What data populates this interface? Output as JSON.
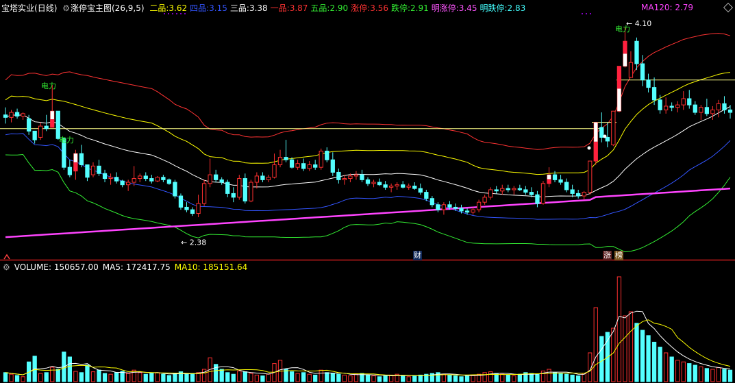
{
  "header": {
    "stock": "宝塔实业",
    "period": "(日线)",
    "indicator": "涨停宝主图",
    "params": "(26,9,5)",
    "items": [
      {
        "label": "二品:",
        "value": "3.62",
        "color": "#ffff00"
      },
      {
        "label": "四品:",
        "value": "3.15",
        "color": "#3355ff"
      },
      {
        "label": "三品:",
        "value": "3.38",
        "color": "#ffffff"
      },
      {
        "label": "一品:",
        "value": "3.87",
        "color": "#ff3333"
      },
      {
        "label": "五品:",
        "value": "2.90",
        "color": "#33ee33"
      },
      {
        "label": "涨停:",
        "value": "3.56",
        "color": "#ff3333"
      },
      {
        "label": "跌停:",
        "value": "2.91",
        "color": "#33ee33"
      },
      {
        "label": "明涨停:",
        "value": "3.45",
        "color": "#ff55ff"
      },
      {
        "label": "明跌停:",
        "value": "2.83",
        "color": "#44ffff"
      }
    ],
    "ma120": "MA120: 2.79"
  },
  "volume_header": {
    "volume": "VOLUME: 150657.00",
    "ma5": "MA5: 172417.75",
    "ma10": "MA10: 185151.64"
  },
  "annotations": {
    "high_label": "4.10",
    "low_label": "2.38",
    "power1": "电力",
    "power2": "电力",
    "power3": "电力",
    "cai_tag": "财",
    "zhang_tag": "涨",
    "bang_tag": "榜"
  },
  "chart_data": {
    "type": "candlestick",
    "price_range": [
      2.3,
      4.2
    ],
    "high": 4.1,
    "low": 2.38,
    "candles": [
      [
        3.4,
        3.46,
        3.33,
        3.38
      ],
      [
        3.38,
        3.44,
        3.34,
        3.42
      ],
      [
        3.42,
        3.45,
        3.37,
        3.39
      ],
      [
        3.39,
        3.42,
        3.36,
        3.41
      ],
      [
        3.37,
        3.4,
        3.24,
        3.27
      ],
      [
        3.27,
        3.26,
        3.17,
        3.2
      ],
      [
        3.22,
        3.34,
        3.2,
        3.31
      ],
      [
        3.31,
        3.4,
        3.27,
        3.29
      ],
      [
        3.3,
        3.64,
        3.3,
        3.43
      ],
      [
        3.43,
        3.36,
        3.2,
        3.21
      ],
      [
        3.21,
        3.02,
        2.96,
        2.98
      ],
      [
        2.98,
        3.04,
        2.9,
        2.92
      ],
      [
        2.95,
        3.12,
        2.88,
        3.09
      ],
      [
        3.09,
        3.16,
        2.98,
        3.0
      ],
      [
        3.0,
        3.0,
        2.87,
        2.9
      ],
      [
        2.92,
        3.02,
        2.9,
        2.99
      ],
      [
        2.99,
        3.04,
        2.91,
        2.93
      ],
      [
        2.93,
        2.96,
        2.86,
        2.89
      ],
      [
        2.89,
        2.93,
        2.84,
        2.9
      ],
      [
        2.9,
        2.94,
        2.85,
        2.87
      ],
      [
        2.87,
        2.88,
        2.82,
        2.84
      ],
      [
        2.84,
        2.88,
        2.79,
        2.86
      ],
      [
        2.86,
        2.99,
        2.83,
        2.89
      ],
      [
        2.89,
        2.93,
        2.86,
        2.91
      ],
      [
        2.91,
        2.94,
        2.87,
        2.89
      ],
      [
        2.89,
        2.92,
        2.85,
        2.87
      ],
      [
        2.87,
        2.91,
        2.86,
        2.9
      ],
      [
        2.9,
        2.92,
        2.86,
        2.88
      ],
      [
        2.88,
        2.89,
        2.84,
        2.85
      ],
      [
        2.86,
        2.88,
        2.73,
        2.75
      ],
      [
        2.75,
        2.77,
        2.64,
        2.66
      ],
      [
        2.66,
        2.7,
        2.62,
        2.64
      ],
      [
        2.64,
        2.66,
        2.59,
        2.61
      ],
      [
        2.61,
        2.76,
        2.58,
        2.69
      ],
      [
        2.69,
        2.88,
        2.67,
        2.85
      ],
      [
        2.85,
        3.05,
        2.82,
        2.92
      ],
      [
        2.92,
        2.96,
        2.86,
        2.88
      ],
      [
        2.88,
        2.9,
        2.84,
        2.86
      ],
      [
        2.86,
        2.88,
        2.74,
        2.77
      ],
      [
        2.77,
        2.82,
        2.7,
        2.74
      ],
      [
        2.74,
        2.92,
        2.72,
        2.89
      ],
      [
        2.89,
        2.93,
        2.69,
        2.71
      ],
      [
        2.71,
        2.88,
        2.7,
        2.86
      ],
      [
        2.86,
        2.94,
        2.81,
        2.91
      ],
      [
        2.91,
        2.94,
        2.86,
        2.88
      ],
      [
        2.88,
        2.92,
        2.86,
        2.9
      ],
      [
        2.9,
        3.09,
        2.89,
        3.0
      ],
      [
        3.0,
        3.12,
        2.98,
        3.06
      ],
      [
        3.06,
        3.2,
        3.02,
        3.04
      ],
      [
        3.04,
        3.06,
        2.97,
        2.98
      ],
      [
        2.98,
        3.04,
        2.96,
        3.01
      ],
      [
        3.01,
        3.05,
        2.95,
        2.97
      ],
      [
        2.97,
        3.03,
        2.95,
        3.0
      ],
      [
        3.0,
        3.04,
        2.96,
        2.98
      ],
      [
        2.98,
        3.13,
        2.96,
        3.11
      ],
      [
        3.11,
        3.14,
        3.02,
        3.04
      ],
      [
        3.04,
        3.1,
        2.91,
        2.94
      ],
      [
        2.94,
        2.97,
        2.85,
        2.88
      ],
      [
        2.88,
        2.92,
        2.84,
        2.89
      ],
      [
        2.89,
        2.93,
        2.86,
        2.91
      ],
      [
        2.91,
        2.95,
        2.88,
        2.92
      ],
      [
        2.92,
        2.96,
        2.86,
        2.88
      ],
      [
        2.88,
        2.9,
        2.83,
        2.85
      ],
      [
        2.85,
        2.88,
        2.82,
        2.86
      ],
      [
        2.86,
        2.89,
        2.83,
        2.84
      ],
      [
        2.84,
        2.87,
        2.8,
        2.82
      ],
      [
        2.82,
        2.85,
        2.78,
        2.83
      ],
      [
        2.83,
        2.86,
        2.8,
        2.84
      ],
      [
        2.84,
        2.87,
        2.81,
        2.82
      ],
      [
        2.82,
        2.85,
        2.8,
        2.83
      ],
      [
        2.83,
        2.86,
        2.8,
        2.81
      ],
      [
        2.81,
        2.85,
        2.76,
        2.78
      ],
      [
        2.78,
        2.8,
        2.71,
        2.73
      ],
      [
        2.73,
        2.75,
        2.66,
        2.68
      ],
      [
        2.68,
        2.7,
        2.62,
        2.64
      ],
      [
        2.64,
        2.7,
        2.6,
        2.68
      ],
      [
        2.68,
        2.71,
        2.64,
        2.66
      ],
      [
        2.66,
        2.69,
        2.63,
        2.65
      ],
      [
        2.65,
        2.68,
        2.61,
        2.63
      ],
      [
        2.63,
        2.65,
        2.6,
        2.62
      ],
      [
        2.62,
        2.66,
        2.6,
        2.64
      ],
      [
        2.64,
        2.72,
        2.62,
        2.7
      ],
      [
        2.7,
        2.76,
        2.68,
        2.74
      ],
      [
        2.74,
        2.82,
        2.72,
        2.8
      ],
      [
        2.8,
        2.83,
        2.77,
        2.79
      ],
      [
        2.79,
        2.84,
        2.76,
        2.81
      ],
      [
        2.81,
        2.84,
        2.78,
        2.8
      ],
      [
        2.8,
        2.83,
        2.76,
        2.81
      ],
      [
        2.81,
        2.84,
        2.79,
        2.8
      ],
      [
        2.8,
        2.83,
        2.76,
        2.78
      ],
      [
        2.78,
        2.82,
        2.74,
        2.76
      ],
      [
        2.76,
        2.79,
        2.66,
        2.69
      ],
      [
        2.69,
        2.87,
        2.68,
        2.85
      ],
      [
        2.85,
        2.98,
        2.82,
        2.92
      ],
      [
        2.92,
        2.95,
        2.86,
        2.88
      ],
      [
        2.88,
        2.92,
        2.84,
        2.86
      ],
      [
        2.86,
        2.89,
        2.78,
        2.8
      ],
      [
        2.8,
        2.84,
        2.74,
        2.77
      ],
      [
        2.77,
        2.8,
        2.73,
        2.75
      ],
      [
        2.75,
        2.79,
        2.72,
        2.78
      ],
      [
        2.78,
        3.03,
        2.76,
        3.03
      ],
      [
        3.03,
        3.34,
        3.0,
        3.34
      ],
      [
        3.3,
        3.42,
        3.18,
        3.22
      ],
      [
        3.22,
        3.34,
        3.14,
        3.19
      ],
      [
        3.16,
        3.43,
        3.15,
        3.43
      ],
      [
        3.43,
        3.79,
        3.42,
        3.79
      ],
      [
        3.79,
        4.1,
        3.78,
        3.99
      ],
      [
        3.7,
        3.91,
        3.7,
        3.82
      ],
      [
        3.99,
        4.02,
        3.76,
        3.81
      ],
      [
        3.81,
        3.88,
        3.63,
        3.68
      ],
      [
        3.68,
        3.73,
        3.58,
        3.62
      ],
      [
        3.62,
        3.7,
        3.48,
        3.52
      ],
      [
        3.52,
        3.56,
        3.41,
        3.44
      ],
      [
        3.44,
        3.54,
        3.41,
        3.47
      ],
      [
        3.47,
        3.5,
        3.43,
        3.46
      ],
      [
        3.46,
        3.51,
        3.42,
        3.48
      ],
      [
        3.48,
        3.59,
        3.44,
        3.53
      ],
      [
        3.53,
        3.6,
        3.45,
        3.48
      ],
      [
        3.48,
        3.51,
        3.4,
        3.42
      ],
      [
        3.42,
        3.48,
        3.36,
        3.46
      ],
      [
        3.46,
        3.53,
        3.39,
        3.41
      ],
      [
        3.41,
        3.47,
        3.36,
        3.44
      ],
      [
        3.44,
        3.52,
        3.38,
        3.49
      ],
      [
        3.49,
        3.55,
        3.41,
        3.44
      ],
      [
        3.44,
        3.48,
        3.37,
        3.42
      ]
    ],
    "volumes": [
      22,
      18,
      15,
      12,
      48,
      62,
      20,
      22,
      35,
      30,
      72,
      60,
      25,
      22,
      40,
      24,
      28,
      20,
      18,
      22,
      25,
      20,
      28,
      22,
      18,
      20,
      22,
      18,
      15,
      20,
      24,
      18,
      20,
      22,
      30,
      58,
      42,
      30,
      22,
      18,
      26,
      24,
      20,
      16,
      14,
      18,
      44,
      52,
      30,
      24,
      20,
      22,
      18,
      16,
      28,
      22,
      20,
      18,
      16,
      14,
      18,
      20,
      16,
      14,
      12,
      14,
      16,
      18,
      14,
      12,
      14,
      16,
      18,
      20,
      22,
      18,
      16,
      14,
      12,
      14,
      16,
      18,
      22,
      24,
      20,
      18,
      16,
      14,
      18,
      22,
      20,
      18,
      26,
      30,
      22,
      20,
      18,
      16,
      14,
      20,
      70,
      180,
      110,
      120,
      130,
      255,
      160,
      170,
      142,
      125,
      112,
      96,
      84,
      70,
      60,
      52,
      48,
      44,
      40,
      36,
      32,
      30,
      34,
      30,
      28
    ],
    "vol_max": 265,
    "lines": {
      "yi_pin": {
        "name": "一品",
        "color": "#ff3333"
      },
      "er_pin": {
        "name": "二品",
        "color": "#ffff00"
      },
      "san_pin": {
        "name": "三品",
        "color": "#ffffff"
      },
      "si_pin": {
        "name": "四品",
        "color": "#3355ff"
      },
      "wu_pin": {
        "name": "五品",
        "color": "#33ee33"
      },
      "ma120": {
        "name": "MA120",
        "color": "#ff44ff"
      }
    }
  }
}
